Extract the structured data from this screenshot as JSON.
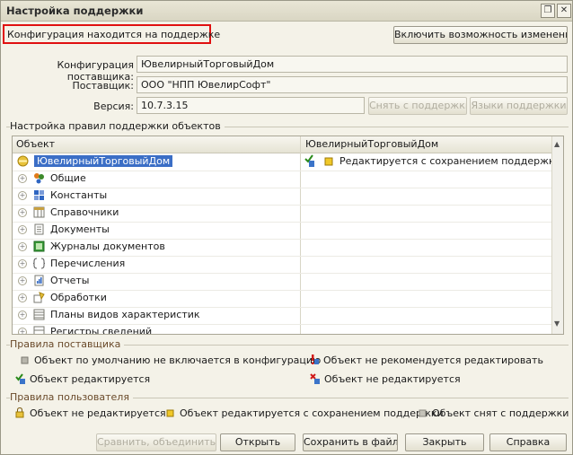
{
  "window": {
    "title": "Настройка поддержки"
  },
  "notice": "Конфигурация находится на поддержке",
  "buttons": {
    "enable_changes": "Включить возможность изменения",
    "remove_support": "Снять с поддержки",
    "support_languages": "Языки поддержки",
    "compare_merge": "Сравнить, объединить",
    "open": "Открыть",
    "save_to_file": "Сохранить в файл",
    "close": "Закрыть",
    "help": "Справка"
  },
  "fields": {
    "vendor_config_label": "Конфигурация поставщика:",
    "vendor_config_value": "ЮвелирныйТорговыйДом",
    "vendor_label": "Поставщик:",
    "vendor_value": "ООО \"НПП ЮвелирСофт\"",
    "version_label": "Версия:",
    "version_value": "10.7.3.15"
  },
  "rules_group": {
    "title": "Настройка правил поддержки объектов"
  },
  "table": {
    "columns": [
      "Объект",
      "ЮвелирныйТорговыйДом"
    ],
    "rows": [
      {
        "label": "ЮвелирныйТорговыйДом",
        "value": "Редактируется с сохранением поддержки",
        "icon": "root-config-icon",
        "selected": true
      },
      {
        "label": "Общие",
        "value": "",
        "icon": "common-icon"
      },
      {
        "label": "Константы",
        "value": "",
        "icon": "constants-icon"
      },
      {
        "label": "Справочники",
        "value": "",
        "icon": "catalogs-icon"
      },
      {
        "label": "Документы",
        "value": "",
        "icon": "documents-icon"
      },
      {
        "label": "Журналы документов",
        "value": "",
        "icon": "journals-icon"
      },
      {
        "label": "Перечисления",
        "value": "",
        "icon": "enums-icon"
      },
      {
        "label": "Отчеты",
        "value": "",
        "icon": "reports-icon"
      },
      {
        "label": "Обработки",
        "value": "",
        "icon": "processing-icon"
      },
      {
        "label": "Планы видов характеристик",
        "value": "",
        "icon": "char-plans-icon"
      },
      {
        "label": "Регистры сведений",
        "value": "",
        "icon": "registers-icon"
      }
    ]
  },
  "vendor_rules": {
    "title": "Правила поставщика",
    "items": [
      "Объект по умолчанию не включается в конфигурацию",
      "Объект не рекомендуется редактировать",
      "Объект редактируется",
      "Объект не редактируется"
    ]
  },
  "user_rules": {
    "title": "Правила пользователя",
    "items": [
      "Объект не редактируется",
      "Объект редактируется с сохранением поддержки",
      "Объект снят с поддержки"
    ]
  }
}
